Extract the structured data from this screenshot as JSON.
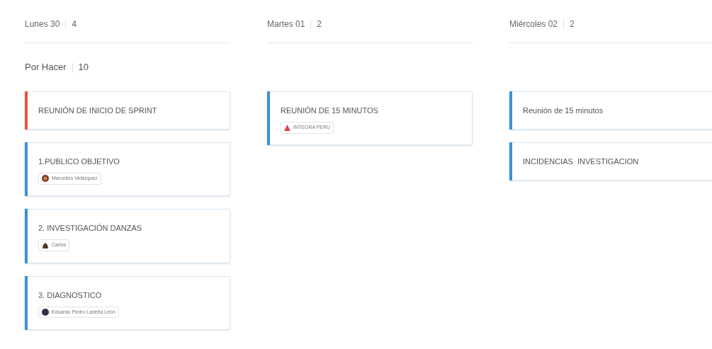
{
  "columns": [
    {
      "day": "Lunes 30",
      "count": "4",
      "group": {
        "label": "Por Hacer",
        "count": "10"
      },
      "cards": [
        {
          "title": "REUNIÓN DE INICIO DE SPRINT",
          "color": "#e8553e"
        },
        {
          "title": "1.PUBLICO OBJETIVO",
          "color": "#3b8fde",
          "assignee": {
            "name": "Marcelino Velázquez",
            "kind": "shield"
          }
        },
        {
          "title": "2. INVESTIGACIÓN DANZAS",
          "color": "#3b8fde",
          "assignee": {
            "name": "Carlos",
            "kind": "figure"
          }
        },
        {
          "title": "3. DIAGNOSTICO",
          "color": "#3b8fde",
          "assignee": {
            "name": "Eduardo Pedro Ladeña León",
            "kind": "circle"
          }
        }
      ]
    },
    {
      "day": "Martes 01",
      "count": "2",
      "cards": [
        {
          "title": "REUNIÓN DE 15 MINUTOS",
          "color": "#3b8fde",
          "assignee": {
            "name": "INTEGRA PERU",
            "kind": "triangle"
          }
        }
      ]
    },
    {
      "day": "Miércoles 02",
      "count": "2",
      "cards": [
        {
          "title": "Reunión de 15 minutos",
          "color": "#3b8fde"
        },
        {
          "title": "INCIDENCIAS  INVESTIGACION",
          "color": "#3b8fde"
        }
      ]
    }
  ]
}
